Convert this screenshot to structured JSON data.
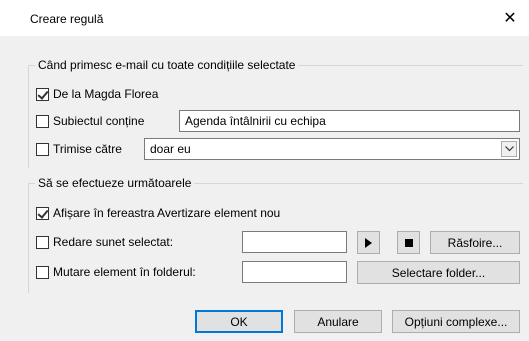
{
  "window": {
    "title": "Creare regulă",
    "close_glyph": "✕"
  },
  "conditions": {
    "legend": "Când primesc e-mail cu toate condițiile selectate",
    "from": {
      "checked": true,
      "label": "De la Magda Florea"
    },
    "subject": {
      "checked": false,
      "label": "Subiectul conține",
      "value": "Agenda întâlnirii cu echipa"
    },
    "sent_to": {
      "checked": false,
      "label": "Trimise către",
      "value": "doar eu"
    }
  },
  "actions": {
    "legend": "Să se efectueze următoarele",
    "alert": {
      "checked": true,
      "label": "Afișare în fereastra Avertizare element nou"
    },
    "sound": {
      "checked": false,
      "label": "Redare sunet selectat:",
      "value": "",
      "browse_label": "Răsfoire..."
    },
    "move": {
      "checked": false,
      "label": "Mutare element în folderul:",
      "value": "",
      "select_label": "Selectare folder..."
    }
  },
  "footer": {
    "ok_label": "OK",
    "cancel_label": "Anulare",
    "advanced_label": "Opțiuni complexe..."
  }
}
